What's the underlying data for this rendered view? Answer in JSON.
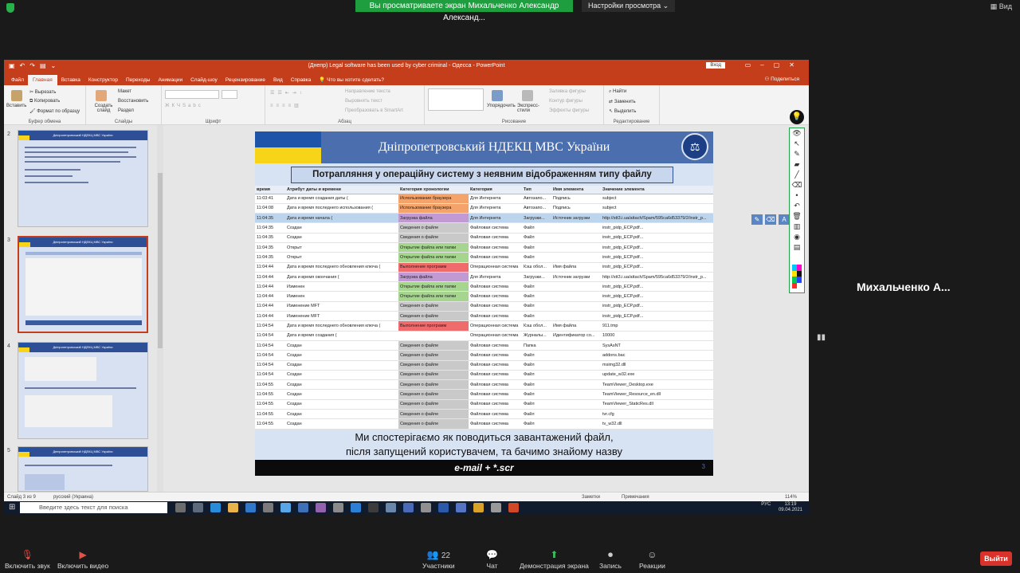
{
  "zoom": {
    "banner": "Вы просматриваете экран Михальченко Александр Александ...",
    "view_settings": "Настройки просмотра",
    "view_button": "Вид",
    "participant_name": "Михальченко  А...",
    "participants_count": "22",
    "bottom": {
      "mute": "Включить звук",
      "video": "Включить видео",
      "participants": "Участники",
      "chat": "Чат",
      "share": "Демонстрация экрана",
      "record": "Запись",
      "reactions": "Реакции",
      "exit": "Выйти"
    }
  },
  "ppt": {
    "title": "(Днепр) Legal software has been used by cyber criminal - Одесса - PowerPoint",
    "signin": "Вход",
    "tabs": [
      "Файл",
      "Главная",
      "Вставка",
      "Конструктор",
      "Переходы",
      "Анимации",
      "Слайд-шоу",
      "Рецензирование",
      "Вид",
      "Справка",
      "Что вы хотите сделать?"
    ],
    "share": "Поделиться",
    "ribbon": {
      "clipboard_label": "Буфер обмена",
      "paste": "Вставить",
      "cut": "Вырезать",
      "copy": "Копировать",
      "format_painter": "Формат по образцу",
      "slides_label": "Слайды",
      "new_slide": "Создать слайд",
      "layout": "Макет",
      "reset": "Восстановить",
      "section": "Раздел",
      "font_label": "Шрифт",
      "paragraph_label": "Абзац",
      "text_direction": "Направление текста",
      "align_text": "Выровнять текст",
      "smartart": "Преобразовать в SmartArt",
      "drawing_label": "Рисование",
      "arrange": "Упорядочить",
      "quick_styles": "Экспресс-стили",
      "shape_fill": "Заливка фигуры",
      "shape_outline": "Контур фигуры",
      "shape_effects": "Эффекты фигуры",
      "editing_label": "Редактирование",
      "find": "Найти",
      "replace": "Заменить",
      "select": "Выделить"
    },
    "slide_numbers": [
      "2",
      "3",
      "4",
      "5"
    ],
    "thumb_heading": "Дніпропетровський НДЕКЦ МВС України",
    "status": {
      "slide": "Слайд 3 из 9",
      "lang": "русский (Украина)",
      "notes": "Заметки",
      "comments": "Примечания",
      "zoom": "114%"
    },
    "taskbar": {
      "search": "Введите здесь текст для поиска",
      "time": "13:19",
      "date": "09.04.2021",
      "lang": "РУС"
    }
  },
  "slide": {
    "title": "Дніпропетровський НДЕКЦ МВС України",
    "subtitle": "Потрапляння у операційну систему з неявним відображенням типу файлу",
    "headers": [
      "время",
      "Атрибут даты и времени",
      "Категория хронологии",
      "Категория",
      "Тип",
      "Имя элемента",
      "Значение элемента"
    ],
    "rows": [
      [
        "11:03:41",
        "Дата и время создания даты (",
        "Использование браузера",
        "Для Интернета",
        "Автозапо...",
        "Подпись",
        "subject"
      ],
      [
        "11:04:08",
        "Дата и время последнего использования (",
        "Использование браузера",
        "Для Интернета",
        "Автозапо...",
        "Подпись",
        "subject"
      ],
      [
        "11:04:35",
        "Дата и время начала (",
        "Загрузка файла",
        "Для Интернета",
        "Загрузки...",
        "Источник загрузки",
        "http://stt3.i.ua/attach/Spam/595ca6d53379/2/instr_p..."
      ],
      [
        "11:04:35",
        "Создан",
        "Сведения о файле",
        "Файловая система",
        "Файл",
        "",
        "instr_pidp_ECP.pdf..."
      ],
      [
        "11:04:35",
        "Создан",
        "Сведения о файле",
        "Файловая система",
        "Файл",
        "",
        "instr_pidp_ECP.pdf..."
      ],
      [
        "11:04:35",
        "Открыт",
        "Открытие файла или папки",
        "Файловая система",
        "Файл",
        "",
        "instr_pidp_ECP.pdf..."
      ],
      [
        "11:04:35",
        "Открыт",
        "Открытие файла или папки",
        "Файловая система",
        "Файл",
        "",
        "instr_pidp_ECP.pdf..."
      ],
      [
        "11:04:44",
        "Дата и время последнего обновления ключа (",
        "Выполнение программ",
        "Операционная система",
        "Кэш обол...",
        "Имя файла",
        "instr_pidp_ECP.pdf..."
      ],
      [
        "11:04:44",
        "Дата и время окончания (",
        "Загрузка файла",
        "Для Интернета",
        "Загрузки...",
        "Источник загрузки",
        "http://stt3.i.ua/attach/Spam/595ca6d53379/2/instr_p..."
      ],
      [
        "11:04:44",
        "Изменен",
        "Открытие файла или папки",
        "Файловая система",
        "Файл",
        "",
        "instr_pidp_ECP.pdf..."
      ],
      [
        "11:04:44",
        "Изменен",
        "Открытие файла или папки",
        "Файловая система",
        "Файл",
        "",
        "instr_pidp_ECP.pdf..."
      ],
      [
        "11:04:44",
        "Изменение MFT",
        "Сведения о файле",
        "Файловая система",
        "Файл",
        "",
        "instr_pidp_ECP.pdf..."
      ],
      [
        "11:04:44",
        "Изменение MFT",
        "Сведения о файле",
        "Файловая система",
        "Файл",
        "",
        "instr_pidp_ECP.pdf..."
      ],
      [
        "11:04:54",
        "Дата и время последнего обновления ключа (",
        "Выполнение программ",
        "Операционная система",
        "Кэш обол...",
        "Имя файла",
        "911.tmp"
      ],
      [
        "11:04:54",
        "Дата и время создания (",
        "",
        "Операционная система",
        "Журналы...",
        "Идентификатор со...",
        "10000"
      ],
      [
        "11:04:54",
        "Создан",
        "Сведения о файле",
        "Файловая система",
        "Папка",
        "",
        "SysAsNT"
      ],
      [
        "11:04:54",
        "Создан",
        "Сведения о файле",
        "Файловая система",
        "Файл",
        "",
        "addons.bac"
      ],
      [
        "11:04:54",
        "Создан",
        "Сведения о файле",
        "Файловая система",
        "Файл",
        "",
        "msimg32.dll"
      ],
      [
        "11:04:54",
        "Создан",
        "Сведения о файле",
        "Файловая система",
        "Файл",
        "",
        "update_w32.exe"
      ],
      [
        "11:04:55",
        "Создан",
        "Сведения о файле",
        "Файловая система",
        "Файл",
        "",
        "TeamViewer_Desktop.exe"
      ],
      [
        "11:04:55",
        "Создан",
        "Сведения о файле",
        "Файловая система",
        "Файл",
        "",
        "TeamViewer_Resource_en.dll"
      ],
      [
        "11:04:55",
        "Создан",
        "Сведения о файле",
        "Файловая система",
        "Файл",
        "",
        "TeamViewer_StaticRes.dll"
      ],
      [
        "11:04:55",
        "Создан",
        "Сведения о файле",
        "Файловая система",
        "Файл",
        "",
        "tvr.cfg"
      ],
      [
        "11:04:55",
        "Создан",
        "Сведения о файле",
        "Файловая система",
        "Файл",
        "",
        "tv_w32.dll"
      ]
    ],
    "row_colors": [
      "orange",
      "orange",
      "purple",
      "grey",
      "grey",
      "green",
      "green",
      "red",
      "purple",
      "green",
      "green",
      "grey",
      "grey",
      "red",
      "",
      "grey",
      "grey",
      "grey",
      "grey",
      "grey",
      "grey",
      "grey",
      "grey",
      "grey"
    ],
    "highlight_row": 2,
    "bottom_line1": "Ми спостерігаємо як поводиться завантажений файл,",
    "bottom_line2": "після запущений користувачем, та бачимо знайому назву",
    "footer": "e-mail + *.scr",
    "page_num": "3"
  }
}
